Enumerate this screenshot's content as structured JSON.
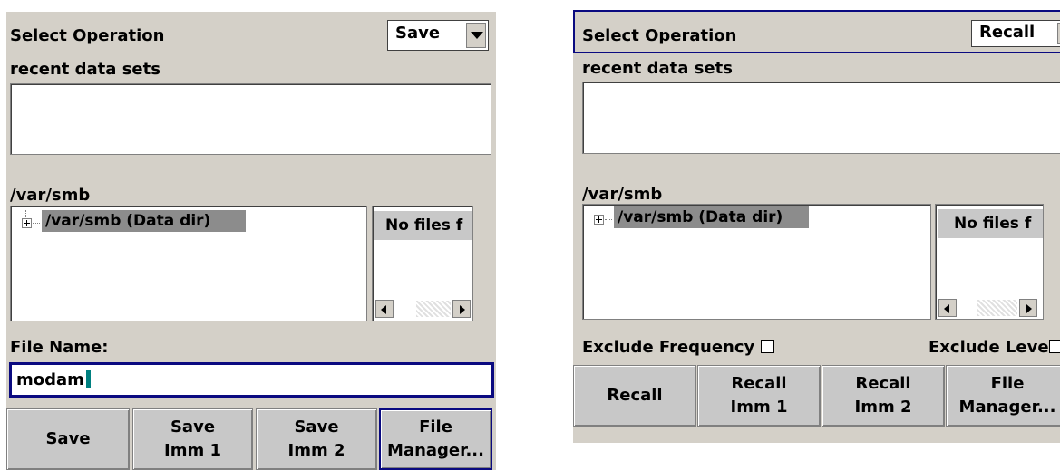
{
  "left": {
    "select_operation_label": "Select Operation",
    "operation_value": "Save",
    "recent_label": "recent data sets",
    "path_label": "/var/smb",
    "tree_node": "/var/smb (Data dir)",
    "files_header": "No files f",
    "file_name_label": "File Name:",
    "file_name_value": "modam",
    "buttons": [
      {
        "line1": "Save",
        "line2": ""
      },
      {
        "line1": "Save",
        "line2": "Imm 1"
      },
      {
        "line1": "Save",
        "line2": "Imm 2"
      },
      {
        "line1": "File",
        "line2": "Manager..."
      }
    ]
  },
  "right": {
    "select_operation_label": "Select Operation",
    "operation_value": "Recall",
    "recent_label": "recent data sets",
    "path_label": "/var/smb",
    "tree_node": "/var/smb (Data dir)",
    "files_header": "No files f",
    "exclude_frequency_label": "Exclude Frequency",
    "exclude_level_label": "Exclude Level",
    "buttons": [
      {
        "line1": "Recall",
        "line2": ""
      },
      {
        "line1": "Recall",
        "line2": "Imm 1"
      },
      {
        "line1": "Recall",
        "line2": "Imm 2"
      },
      {
        "line1": "File",
        "line2": "Manager..."
      }
    ]
  },
  "icons": {
    "dropdown": "chevron-down-icon",
    "tree_expand": "plus-box-icon",
    "scroll_left": "arrow-left-icon",
    "scroll_right": "arrow-right-icon"
  }
}
